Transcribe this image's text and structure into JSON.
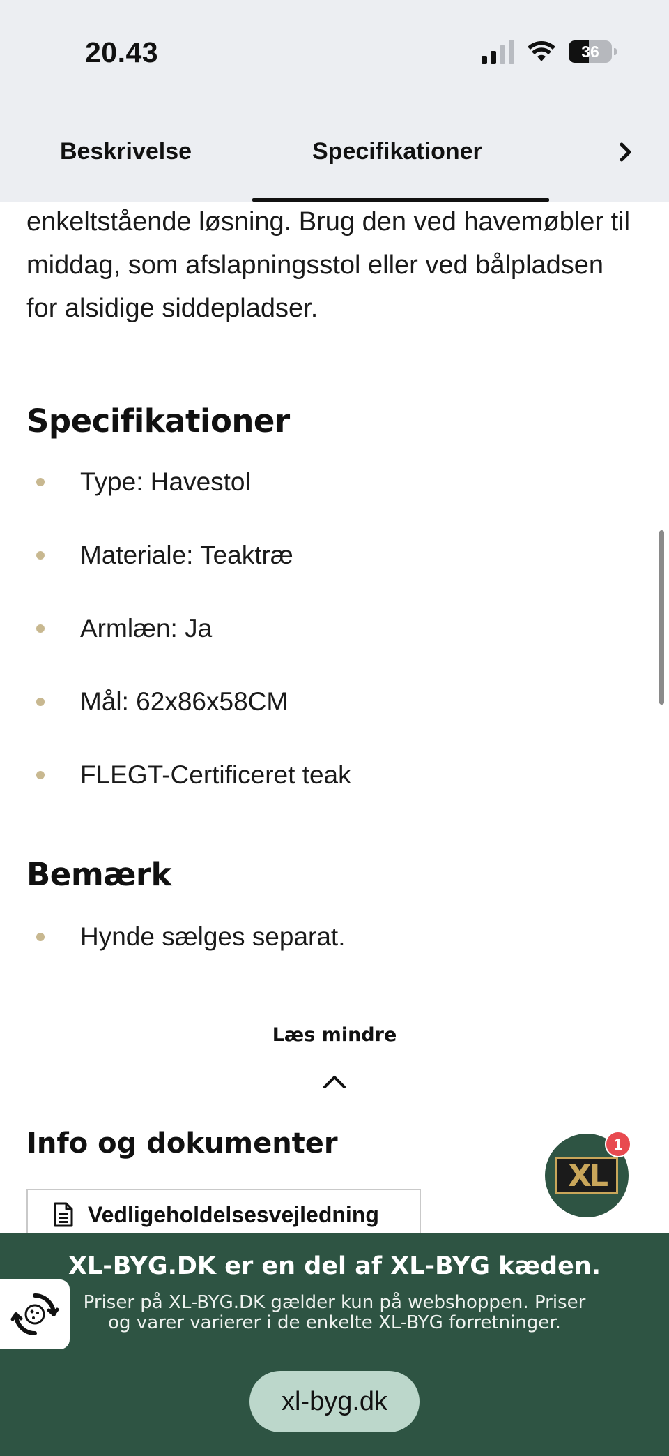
{
  "status_bar": {
    "time": "20.43",
    "battery": "36"
  },
  "tabs": [
    {
      "label": "Beskrivelse"
    },
    {
      "label": "Specifikationer"
    }
  ],
  "description_tail": "enkeltstående løsning. Brug den ved havemøbler til middag, som afslapningsstol eller ved bålpladsen for alsidige siddepladser.",
  "specs_section": {
    "title": "Specifikationer",
    "items": [
      "Type: Havestol",
      "Materiale: Teaktræ",
      "Armlæn: Ja",
      "Mål: 62x86x58CM",
      "FLEGT-Certificeret teak"
    ]
  },
  "note_section": {
    "title": "Bemærk",
    "items": [
      "Hynde sælges separat."
    ]
  },
  "read_less": "Læs mindre",
  "info": {
    "title": "Info og dokumenter",
    "document": "Vedligeholdelsesvejledning"
  },
  "xl_badge": {
    "logo": "XL",
    "count": "1"
  },
  "footer": {
    "title": "XL-BYG.DK er en del af XL-BYG kæden.",
    "subtitle": "Priser på XL-BYG.DK gælder kun på webshoppen. Priser og varer varierer i de enkelte XL-BYG forretninger.",
    "url": "xl-byg.dk"
  },
  "colors": {
    "footer_bg": "#2e5443",
    "bullet": "#c8b890",
    "url_pill": "#bcd7cb",
    "badge_count": "#e84a50"
  }
}
